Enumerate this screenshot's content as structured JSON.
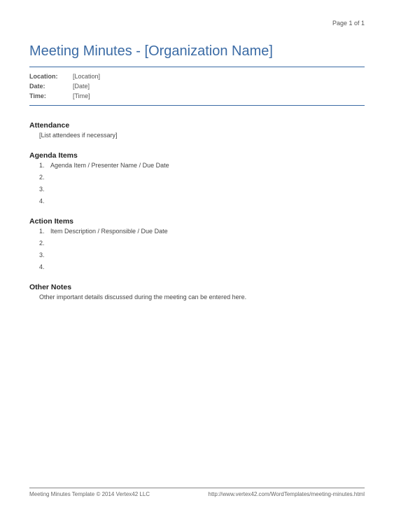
{
  "pageNumber": "Page 1 of 1",
  "title": "Meeting Minutes - [Organization Name]",
  "meta": {
    "locationLabel": "Location:",
    "locationValue": "[Location]",
    "dateLabel": "Date:",
    "dateValue": "[Date]",
    "timeLabel": "Time:",
    "timeValue": "[Time]"
  },
  "sections": {
    "attendance": {
      "heading": "Attendance",
      "text": "[List attendees if necessary]"
    },
    "agenda": {
      "heading": "Agenda Items",
      "items": [
        "Agenda Item / Presenter Name / Due Date",
        "",
        "",
        ""
      ]
    },
    "action": {
      "heading": "Action Items",
      "items": [
        "Item Description / Responsible / Due Date",
        "",
        "",
        ""
      ]
    },
    "other": {
      "heading": "Other Notes",
      "text": "Other important details discussed during the meeting can be entered here."
    }
  },
  "footer": {
    "left": "Meeting Minutes Template © 2014 Vertex42 LLC",
    "right": "http://www.vertex42.com/WordTemplates/meeting-minutes.html"
  }
}
